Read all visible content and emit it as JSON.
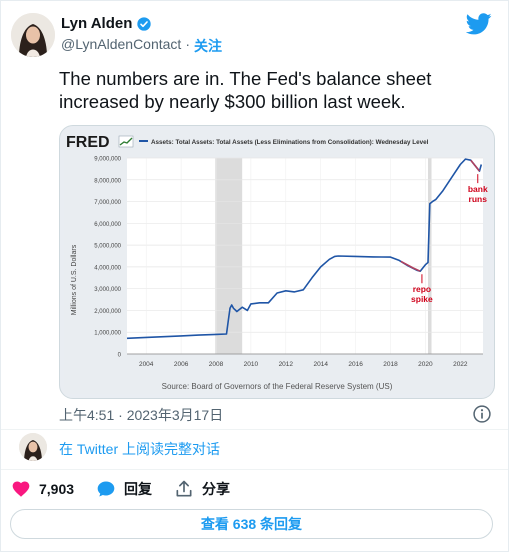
{
  "author": {
    "name": "Lyn Alden",
    "handle": "@LynAldenContact",
    "separator": "·",
    "follow_label": "关注"
  },
  "tweet": {
    "text": "The numbers are in. The Fed's balance sheet increased by nearly $300 billion last week.",
    "timestamp": "上午4:51 · 2023年3月17日"
  },
  "read_on_twitter": "在 Twitter 上阅读完整对话",
  "actions": {
    "likes": "7,903",
    "reply_label": "回复",
    "share_label": "分享"
  },
  "view_replies": "查看 638 条回复",
  "colors": {
    "accent": "#1d9bf0",
    "like": "#f91880",
    "series": "#1f55a6",
    "annotation": "#d0021b"
  },
  "chart_data": {
    "type": "line",
    "logo": "FRED",
    "title": "Assets: Total Assets: Total Assets (Less Eliminations from Consolidation): Wednesday Level",
    "ylabel": "Millions of U.S. Dollars",
    "source": "Source: Board of Governors of the Federal Reserve System (US)",
    "xlim": [
      2002.9,
      2023.3
    ],
    "ylim": [
      0,
      9000000
    ],
    "x_ticks": [
      "2004",
      "2006",
      "2008",
      "2010",
      "2012",
      "2014",
      "2016",
      "2018",
      "2020",
      "2022"
    ],
    "y_ticks": [
      "0",
      "1,000,000",
      "2,000,000",
      "3,000,000",
      "4,000,000",
      "5,000,000",
      "6,000,000",
      "7,000,000",
      "8,000,000",
      "9,000,000"
    ],
    "recessions": [
      [
        2007.95,
        2009.5
      ],
      [
        2020.15,
        2020.35
      ]
    ],
    "series": [
      {
        "x": [
          2002.9,
          2004,
          2006,
          2007,
          2008.0,
          2008.6,
          2008.7,
          2008.8,
          2008.9,
          2009.0,
          2009.2,
          2009.5,
          2009.8,
          2010.0,
          2010.5,
          2011.0,
          2011.5,
          2012.0,
          2012.5,
          2013.0,
          2013.5,
          2014.0,
          2014.5,
          2014.8,
          2015.0,
          2016.0,
          2017.0,
          2018.0,
          2018.5,
          2019.0,
          2019.5,
          2019.7,
          2020.0,
          2020.15,
          2020.25,
          2020.4,
          2020.6,
          2021.0,
          2021.5,
          2022.0,
          2022.3,
          2022.6,
          2022.9,
          2023.1,
          2023.2
        ],
        "y": [
          720000,
          760000,
          830000,
          870000,
          900000,
          920000,
          1500000,
          2100000,
          2250000,
          2100000,
          1950000,
          2150000,
          2000000,
          2300000,
          2350000,
          2350000,
          2800000,
          2900000,
          2850000,
          2950000,
          3500000,
          4000000,
          4350000,
          4480000,
          4500000,
          4480000,
          4460000,
          4450000,
          4300000,
          4050000,
          3850000,
          3800000,
          4100000,
          4200000,
          6900000,
          7000000,
          7100000,
          7500000,
          8100000,
          8700000,
          8950000,
          8900000,
          8600000,
          8400000,
          8700000
        ]
      }
    ],
    "annotations": [
      {
        "text": [
          "repo",
          "spike"
        ],
        "x": 2019.8,
        "y": 3800000
      },
      {
        "text": [
          "bank",
          "runs"
        ],
        "x": 2023.0,
        "y": 8400000
      }
    ]
  }
}
